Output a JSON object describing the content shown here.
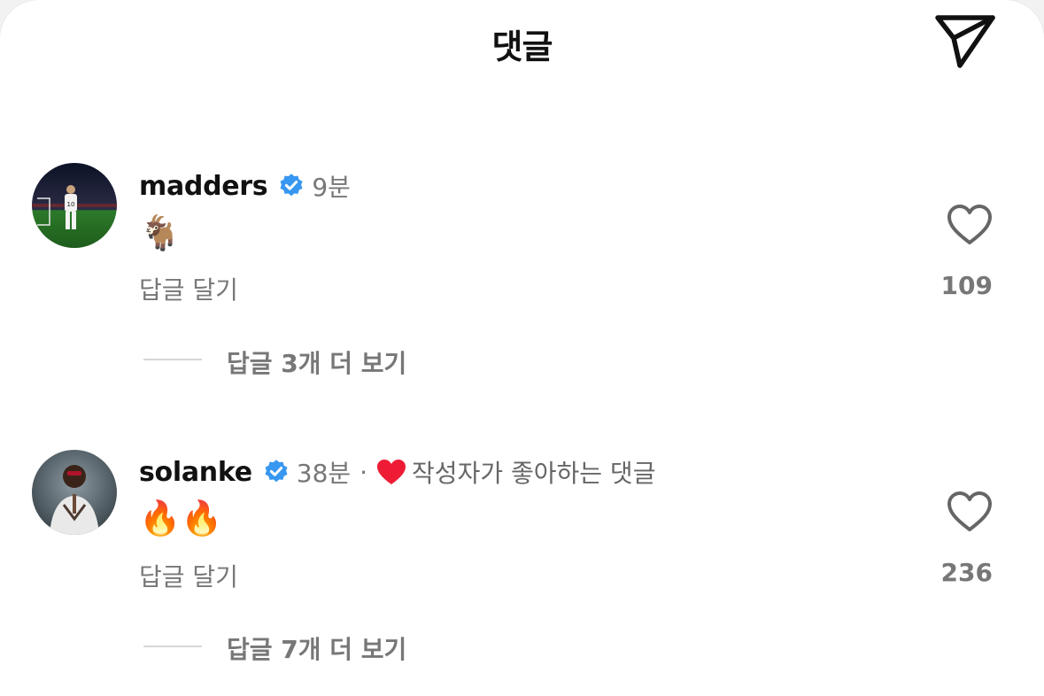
{
  "header": {
    "title": "댓글",
    "send_icon": "paper-plane-icon"
  },
  "colors": {
    "verified": "#3897f0",
    "author_heart": "#ed1c34",
    "muted": "#777777"
  },
  "comments": [
    {
      "username": "madders",
      "verified_icon": "verified-badge-icon",
      "time": "9분",
      "text": "🐐",
      "reply_label": "답글 달기",
      "like_icon": "heart-outline-icon",
      "like_count": "109",
      "more_replies": "답글 3개 더 보기"
    },
    {
      "username": "solanke",
      "verified_icon": "verified-badge-icon",
      "time": "38분",
      "separator": "·",
      "author_liked": "작성자가 좋아하는 댓글",
      "text": "🔥🔥",
      "reply_label": "답글 달기",
      "like_icon": "heart-outline-icon",
      "like_count": "236",
      "more_replies": "답글 7개 더 보기"
    }
  ]
}
